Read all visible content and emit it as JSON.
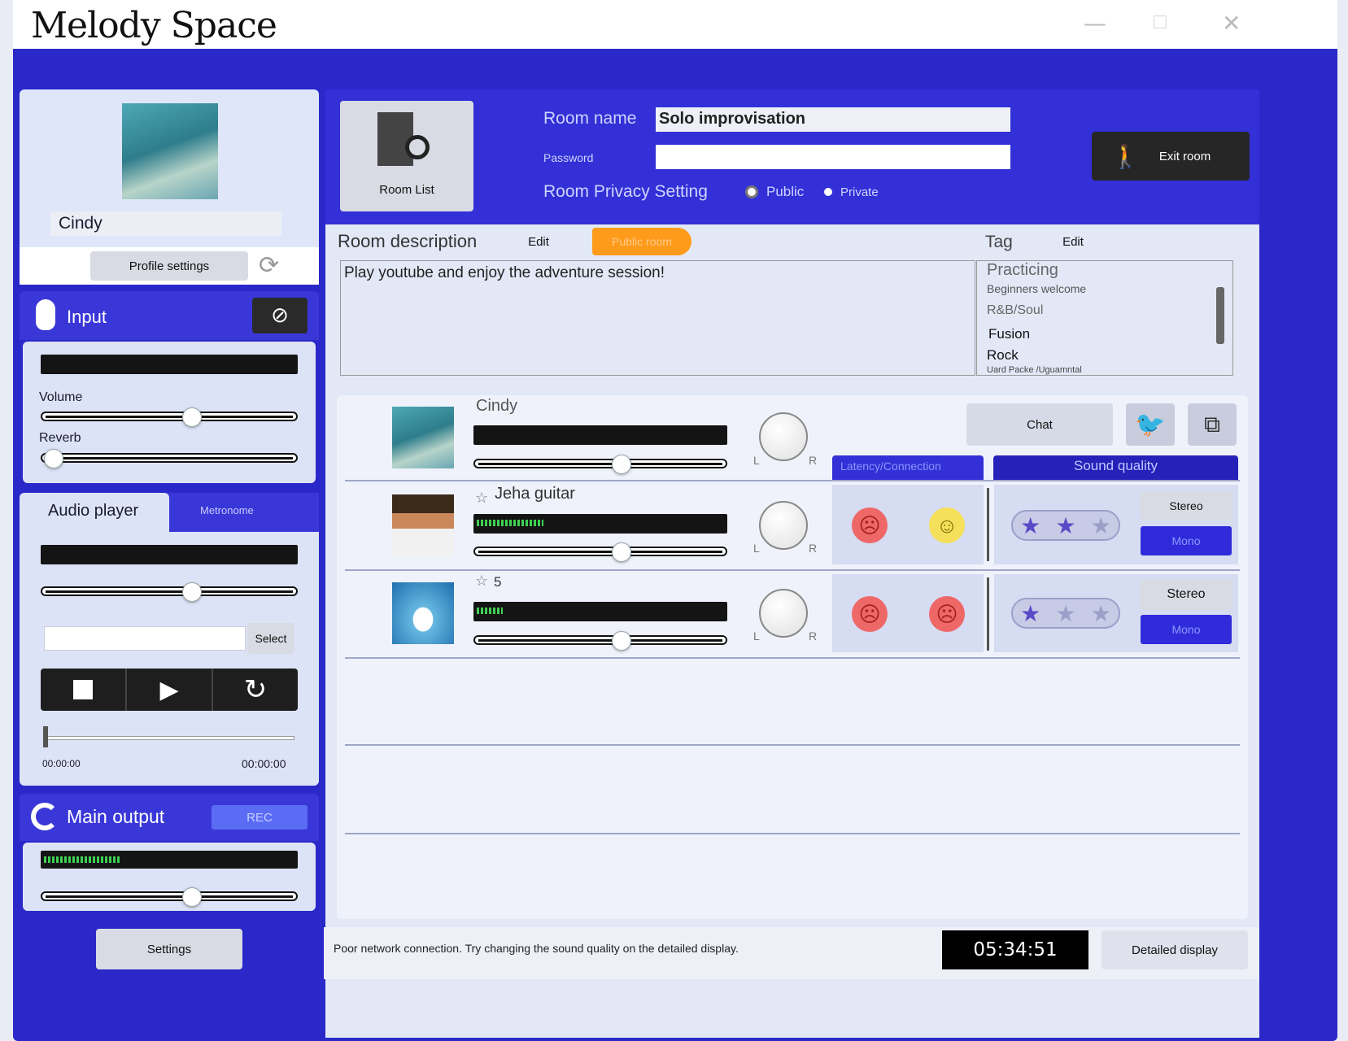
{
  "app": {
    "title": "Melody Space",
    "minimize": "—",
    "maximize": "☐",
    "close": "✕"
  },
  "profile": {
    "name": "Cindy",
    "settings_label": "Profile settings",
    "refresh_icon": "refresh-icon"
  },
  "input": {
    "title": "Input",
    "volume_label": "Volume",
    "reverb_label": "Reverb",
    "volume_level": 0.58,
    "reverb_level": 0.02
  },
  "player": {
    "tab_active": "Audio player",
    "tab_other": "Metronome",
    "select_label": "Select",
    "file_value": "",
    "time_start": "00:00:00",
    "time_end": "00:00:00",
    "volume_level": 0.58
  },
  "output": {
    "title": "Main output",
    "rec_label": "REC",
    "volume_level": 0.58
  },
  "settings_label": "Settings",
  "room": {
    "list_label": "Room List",
    "name_label": "Room name",
    "name_value": "Solo improvisation",
    "password_label": "Password",
    "password_value": "",
    "privacy_label": "Room Privacy Setting",
    "public_label": "Public",
    "private_label": "Private",
    "exit_label": "Exit room"
  },
  "description": {
    "label": "Room description",
    "edit_label": "Edit",
    "badge": "Public room",
    "text": "Play youtube and enjoy the adventure session!"
  },
  "tags": {
    "label": "Tag",
    "edit_label": "Edit",
    "items": [
      "Practicing",
      "Beginners welcome",
      "R&B/Soul",
      "Fusion",
      "Rock",
      "Uard Packe /Uguamntal"
    ]
  },
  "members": {
    "chat_label": "Chat",
    "latency_header": "Latency/Connection",
    "quality_header": "Sound quality",
    "rows": [
      {
        "name": "Cindy",
        "prefix": "",
        "meter": 0,
        "volume": 0.58
      },
      {
        "name": "Jeha guitar",
        "prefix": "☆",
        "meter": 0.28,
        "volume": 0.58,
        "stereo": "Stereo",
        "mono": "Mono",
        "stars": "2 of 3"
      },
      {
        "name": "5",
        "prefix": "☆",
        "meter": 0.11,
        "volume": 0.58,
        "stereo": "Stereo",
        "mono": "Mono",
        "stars": "1 of 3"
      }
    ],
    "pan_left": "L",
    "pan_right": "R"
  },
  "status": {
    "message": "Poor network connection. Try changing the sound quality on the detailed display.",
    "clock": "05:34:51",
    "detail_label": "Detailed display"
  }
}
